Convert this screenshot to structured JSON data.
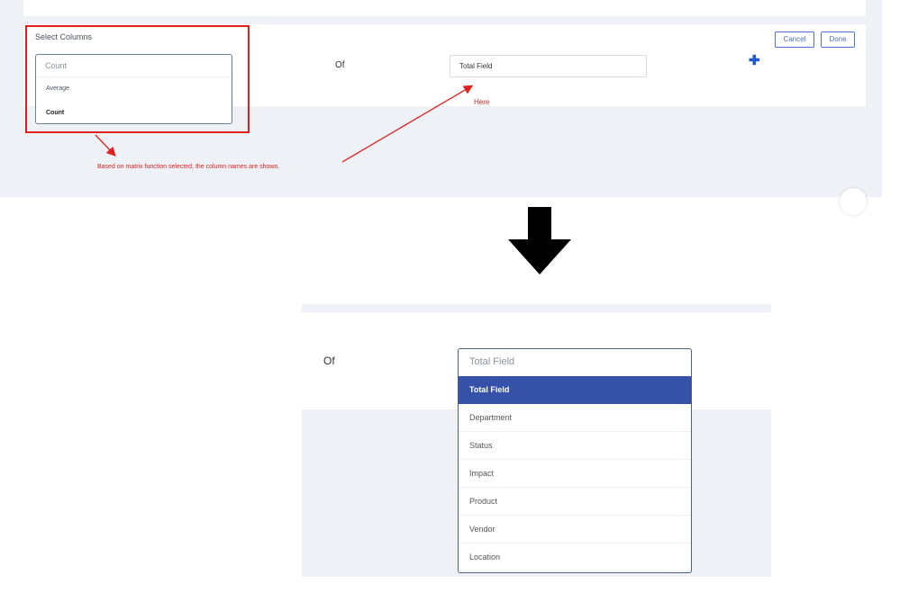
{
  "top": {
    "select_columns_label": "Select Columns",
    "metric_select": {
      "current": "Count",
      "options": [
        "Average",
        "Count"
      ]
    },
    "of_label": "Of",
    "column_select_value": "Total Field",
    "add_icon": "plus-icon",
    "cancel_label": "Cancel",
    "done_label": "Done"
  },
  "annotations": {
    "here": "Here",
    "explanation": "Based on matrix function selected, the column names are shown.",
    "highlight_color": "#e02020"
  },
  "bottom": {
    "of_label": "Of",
    "column_dropdown": {
      "current": "Total Field",
      "selected_index": 0,
      "options": [
        "Total Field",
        "Department",
        "Status",
        "Impact",
        "Product",
        "Vendor",
        "Location"
      ]
    },
    "selected_color": "#3651a8"
  }
}
